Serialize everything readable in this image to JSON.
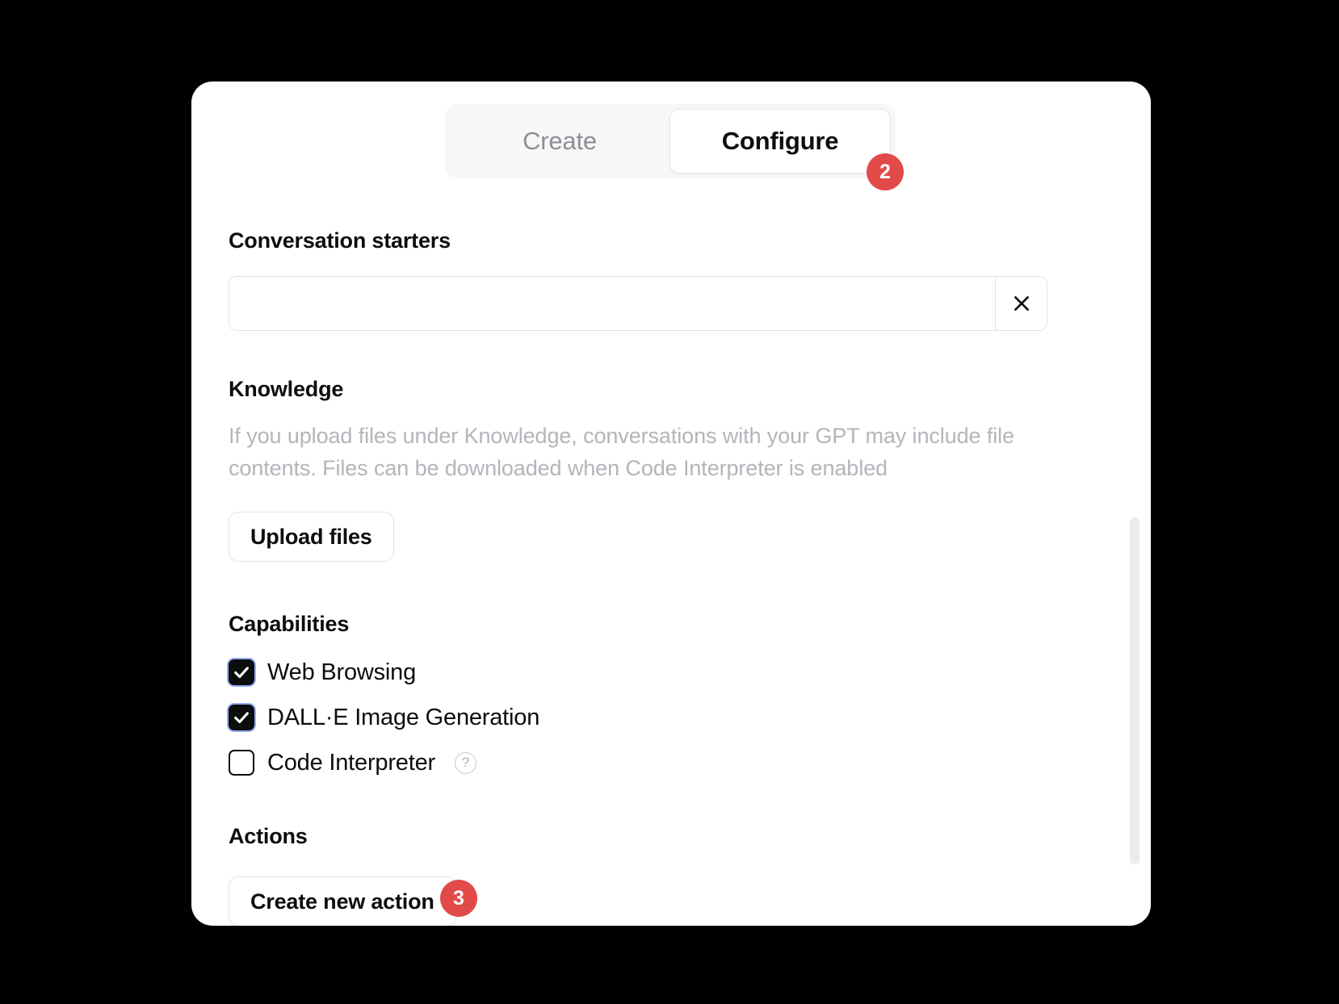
{
  "tabs": {
    "create_label": "Create",
    "configure_label": "Configure",
    "active": "Configure"
  },
  "badges": {
    "configure": "2",
    "create_action": "3",
    "color": "#e24a4a"
  },
  "conversation_starters": {
    "title": "Conversation starters",
    "items": [
      {
        "value": "",
        "placeholder": "",
        "remove_icon": "close-icon"
      }
    ]
  },
  "knowledge": {
    "title": "Knowledge",
    "description": "If you upload files under Knowledge, conversations with your GPT may include file contents. Files can be downloaded when Code Interpreter is enabled",
    "upload_button": "Upload files"
  },
  "capabilities": {
    "title": "Capabilities",
    "items": [
      {
        "label": "Web Browsing",
        "checked": true,
        "help": false
      },
      {
        "label": "DALL·E Image Generation",
        "checked": true,
        "help": false
      },
      {
        "label": "Code Interpreter",
        "checked": false,
        "help": true,
        "help_icon": "question-mark-icon",
        "help_glyph": "?"
      }
    ]
  },
  "actions": {
    "title": "Actions",
    "create_button": "Create new action"
  },
  "scrollbar": {
    "name": "vertical-scrollbar"
  }
}
